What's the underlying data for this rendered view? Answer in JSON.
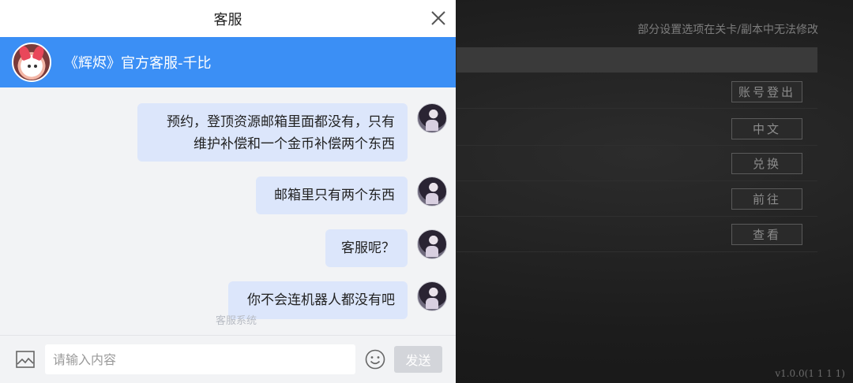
{
  "game": {
    "notice": "部分设置选项在关卡/副本中无法修改",
    "buttons": [
      {
        "label": "账号登出"
      },
      {
        "label": "中文"
      },
      {
        "label": "兑换"
      },
      {
        "label": "前往"
      },
      {
        "label": "查看"
      }
    ],
    "version": "v1.0.0(1 1 1 1)"
  },
  "cs": {
    "title": "客服",
    "agent_name": "《辉烬》官方客服-千比",
    "messages": [
      {
        "sender": "user",
        "lines": [
          "预约，登顶资源邮箱里面都没有，只有",
          "维护补偿和一个金币补偿两个东西"
        ]
      },
      {
        "sender": "user",
        "lines": [
          "邮箱里只有两个东西"
        ]
      },
      {
        "sender": "user",
        "lines": [
          "客服呢？"
        ]
      },
      {
        "sender": "user",
        "lines": [
          "你不会连机器人都没有吧"
        ]
      }
    ],
    "system_watermark": "客服系统",
    "input_placeholder": "请输入内容",
    "send_label": "发送"
  },
  "colors": {
    "agent_bar": "#3b8ff5",
    "user_bubble": "#dce6fb",
    "send_disabled": "#d3d5da"
  }
}
